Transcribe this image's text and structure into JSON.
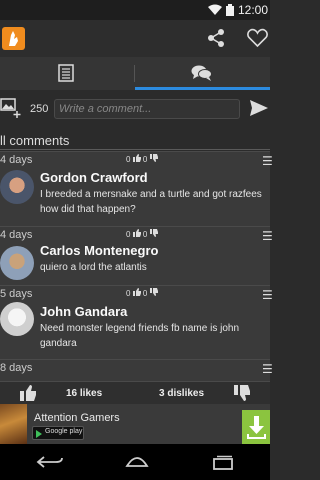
{
  "status": {
    "time": "12:00"
  },
  "tabs": [
    {
      "icon": "document-icon",
      "active": false
    },
    {
      "icon": "chat-bubbles-icon",
      "active": true
    }
  ],
  "composer": {
    "char_count": "250",
    "placeholder": "Write a comment..."
  },
  "comments_header": "ll comments",
  "comments": [
    {
      "age": "4 days",
      "likes": "0",
      "dislikes": "0",
      "name": "Gordon Crawford",
      "text": "I breeded a mersnake and a turtle and got razfees\nhow did that happen?"
    },
    {
      "age": "4 days",
      "likes": "0",
      "dislikes": "0",
      "name": "Carlos Montenegro",
      "text": "quiero a lord the atlantis"
    },
    {
      "age": "5 days",
      "likes": "0",
      "dislikes": "0",
      "name": "John Gandara",
      "text": "Need monster legend friends fb name is john gandara"
    },
    {
      "age": "8 days",
      "likes": "",
      "dislikes": "",
      "name": "",
      "text": ""
    }
  ],
  "reactions": {
    "likes_label": "16 likes",
    "dislikes_label": "3 dislikes"
  },
  "ad": {
    "title": "Attention Gamers",
    "badge": "Google play"
  },
  "colors": {
    "accent": "#2c8bdf",
    "logo": "#f08c1e",
    "download": "#8bc43f"
  }
}
